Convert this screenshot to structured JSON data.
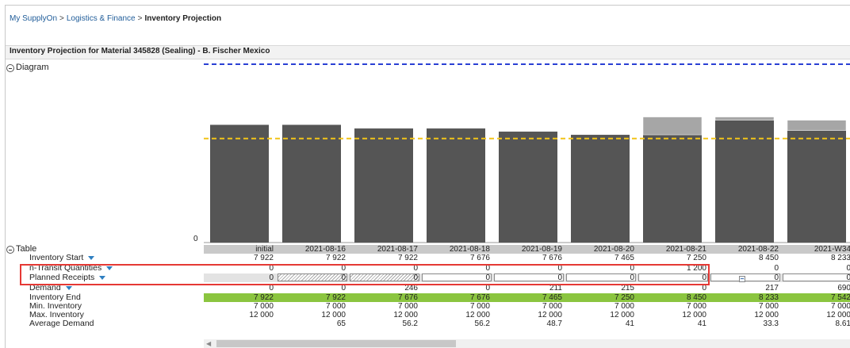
{
  "breadcrumb": {
    "items": [
      "My SupplyOn",
      "Logistics & Finance"
    ],
    "separator": ">",
    "current": "Inventory Projection"
  },
  "panel": {
    "title": "Inventory Projection for Material 345828 (Sealing) - B. Fischer Mexico"
  },
  "sections": {
    "diagram_label": "Diagram",
    "table_label": "Table"
  },
  "chart_data": {
    "type": "bar",
    "categories": [
      "initial",
      "2021-08-16",
      "2021-08-17",
      "2021-08-18",
      "2021-08-19",
      "2021-08-20",
      "2021-08-21",
      "2021-08-22",
      "2021-W34"
    ],
    "series": [
      {
        "values": [
          7922,
          7922,
          7676,
          7676,
          7465,
          7250,
          7250,
          8233,
          7542
        ],
        "color": "#555555"
      },
      {
        "values": [
          0,
          0,
          0,
          0,
          0,
          0,
          1200,
          217,
          690
        ],
        "color": "#a6a6a6"
      }
    ],
    "lines": [
      {
        "value": 7000,
        "color": "#f2c418",
        "style": "dashed"
      },
      {
        "value": 12000,
        "color": "#2a3fd4",
        "style": "dashed"
      }
    ],
    "ylim": [
      0,
      12000
    ],
    "ytick": "0"
  },
  "table": {
    "columns": [
      "initial",
      "2021-08-16",
      "2021-08-17",
      "2021-08-18",
      "2021-08-19",
      "2021-08-20",
      "2021-08-21",
      "2021-08-22",
      "2021-W34"
    ],
    "rows": [
      {
        "label": "Inventory Start",
        "dropdown": true,
        "values": [
          "7 922",
          "7 922",
          "7 922",
          "7 676",
          "7 676",
          "7 465",
          "7 250",
          "8 450",
          "8 233"
        ]
      },
      {
        "label": "n-Transit Quantities",
        "dropdown": true,
        "values": [
          "0",
          "0",
          "0",
          "0",
          "0",
          "0",
          "1 200",
          "0",
          "0"
        ]
      },
      {
        "label": "Planned Receipts",
        "dropdown": true,
        "values": [
          "0",
          "0",
          "0",
          "0",
          "0",
          "0",
          "0",
          "0",
          "0"
        ]
      },
      {
        "label": "Demand",
        "dropdown": true,
        "values": [
          "0",
          "0",
          "246",
          "0",
          "211",
          "215",
          "0",
          "217",
          "690"
        ]
      },
      {
        "label": "Inventory End",
        "dropdown": false,
        "values": [
          "7 922",
          "7 922",
          "7 676",
          "7 676",
          "7 465",
          "7 250",
          "8 450",
          "8 233",
          "7 542"
        ]
      },
      {
        "label": "Min. Inventory",
        "dropdown": false,
        "values": [
          "7 000",
          "7 000",
          "7 000",
          "7 000",
          "7 000",
          "7 000",
          "7 000",
          "7 000",
          "7 000"
        ]
      },
      {
        "label": "Max. Inventory",
        "dropdown": false,
        "values": [
          "12 000",
          "12 000",
          "12 000",
          "12 000",
          "12 000",
          "12 000",
          "12 000",
          "12 000",
          "12 000"
        ]
      },
      {
        "label": "Average Demand",
        "dropdown": false,
        "values": [
          "",
          "65",
          "56.2",
          "56.2",
          "48.7",
          "41",
          "41",
          "33.3",
          "8.61"
        ]
      }
    ]
  },
  "colors": {
    "inventory_end_row": "#8bc53f",
    "highlight_border": "#e53935",
    "link": "#1f5c99"
  }
}
